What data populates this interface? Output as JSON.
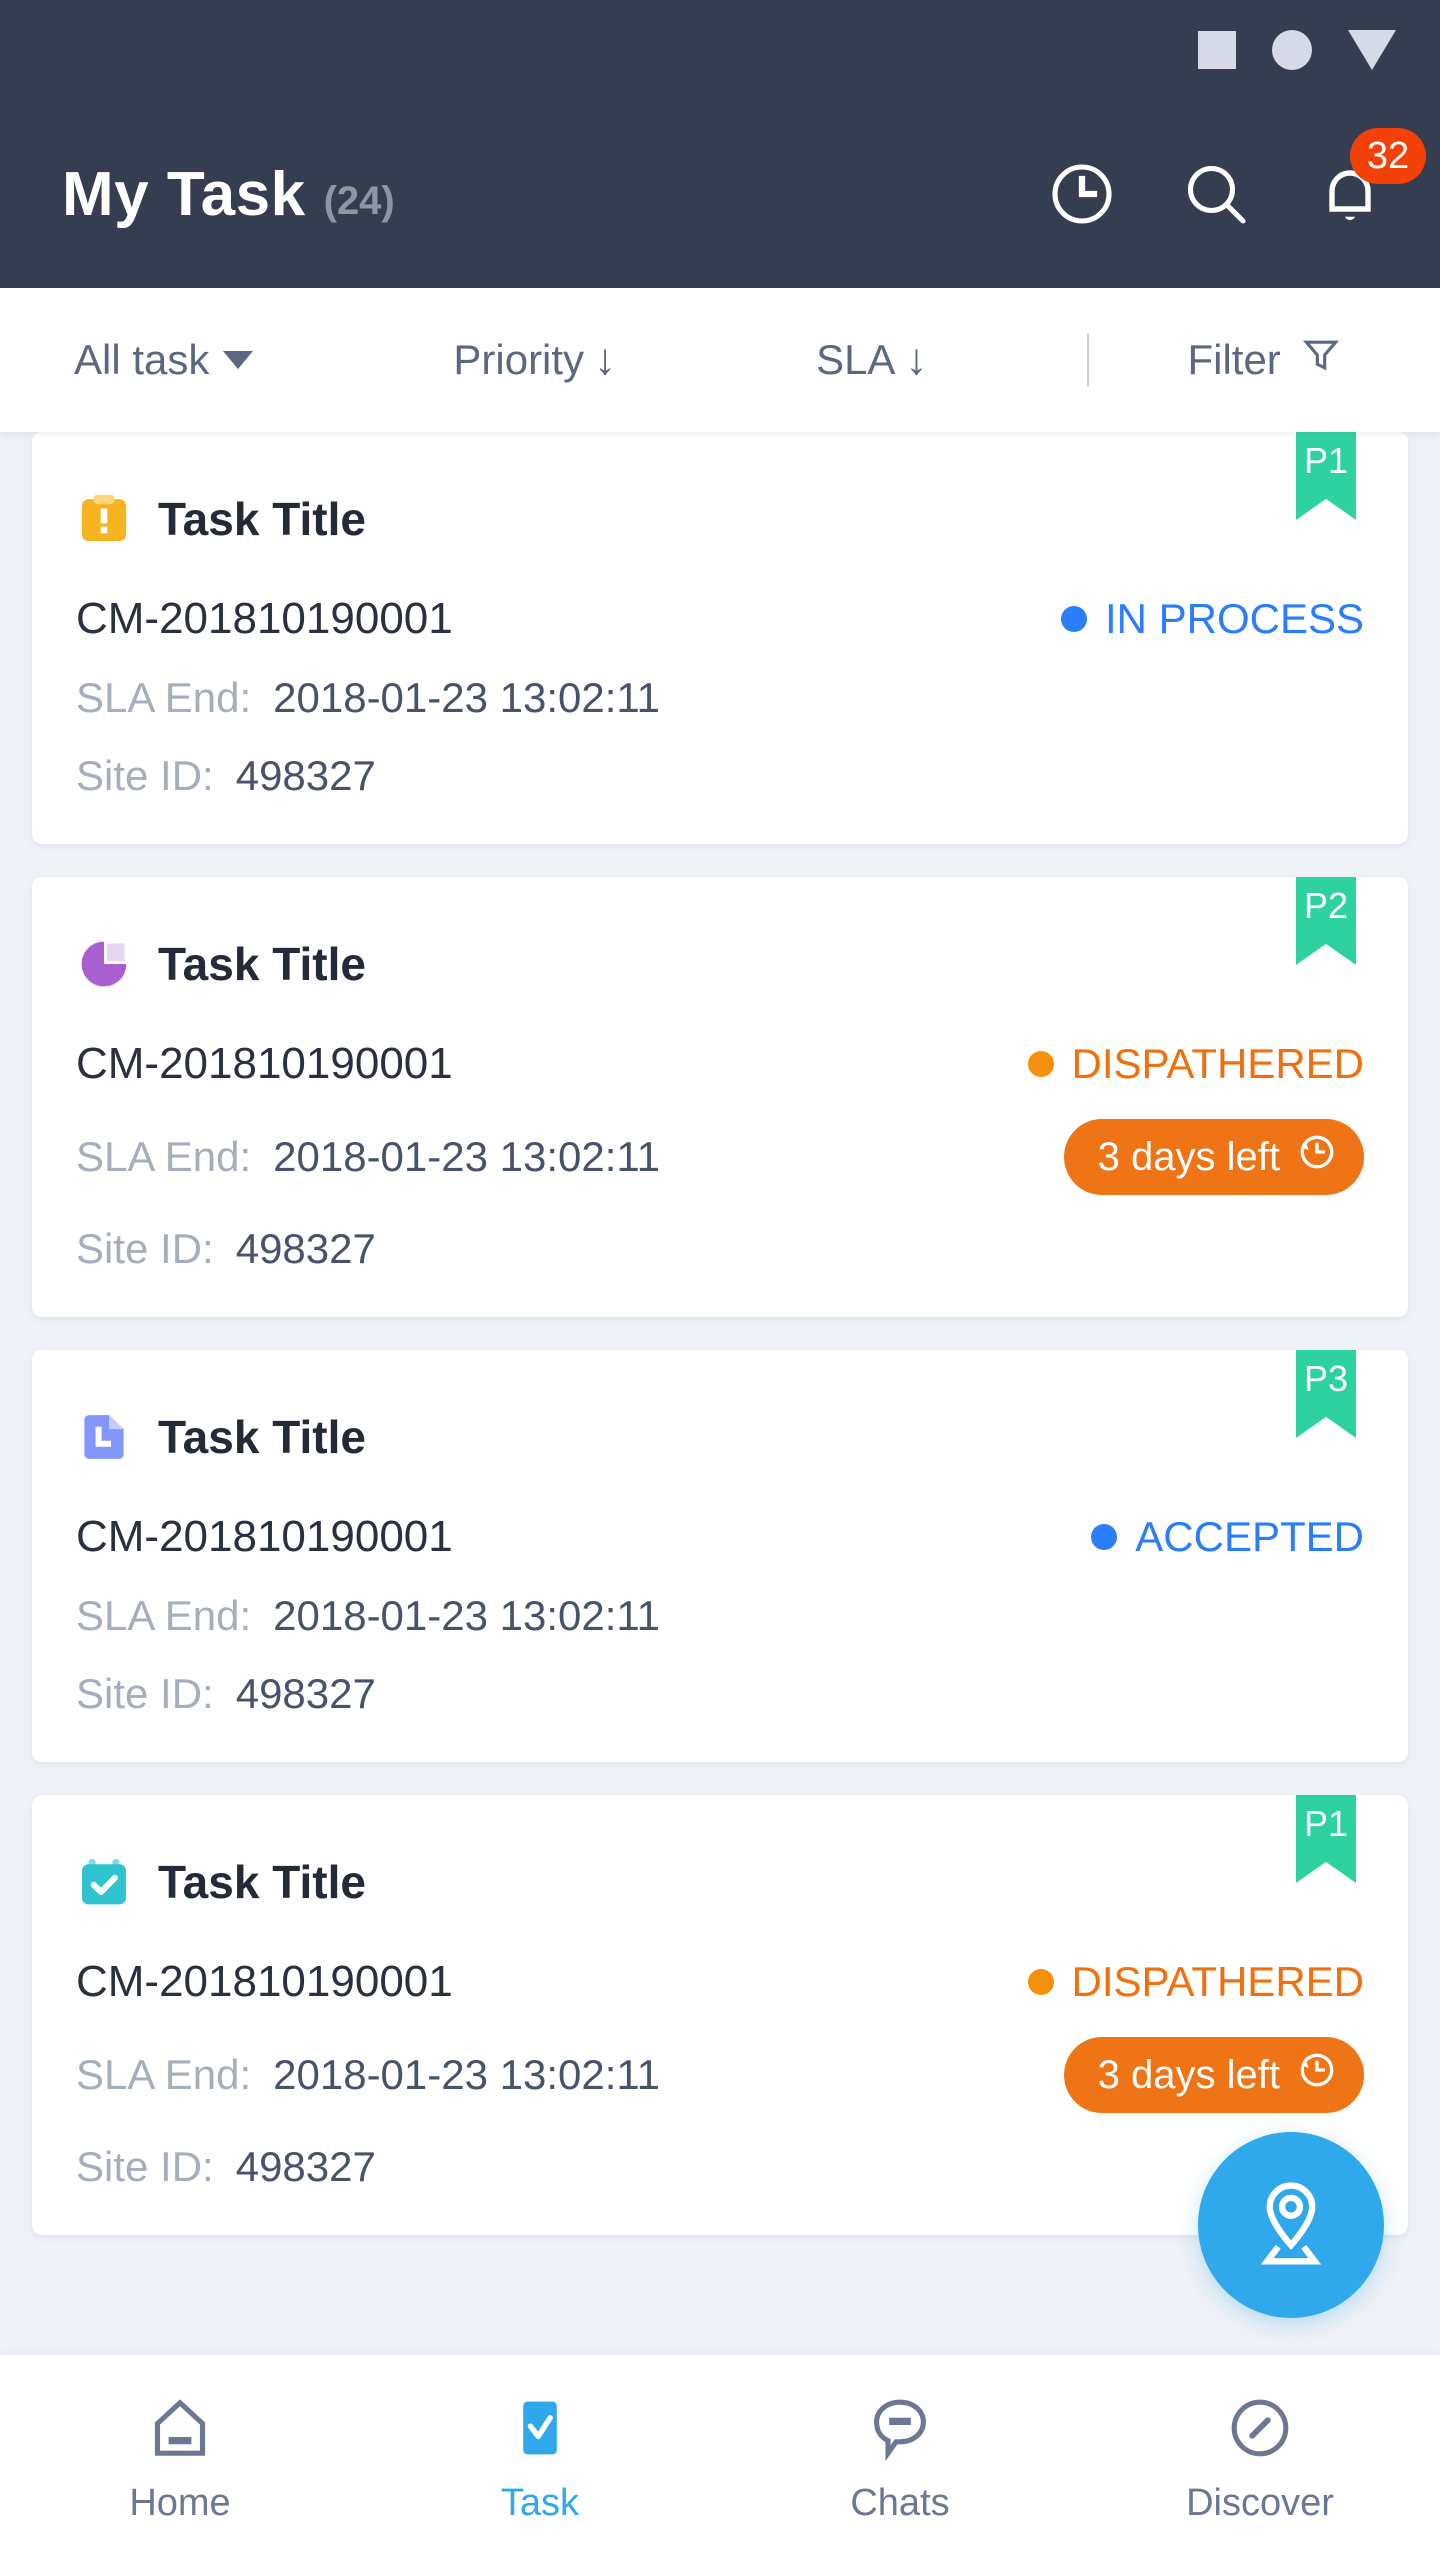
{
  "statusbar": {
    "icons": [
      "square-placeholder-icon",
      "circle-placeholder-icon",
      "triangle-placeholder-icon"
    ]
  },
  "appbar": {
    "title": "My Task",
    "count": "(24)",
    "actions": [
      {
        "name": "history-clock-icon",
        "label": "clock-icon"
      },
      {
        "name": "search-icon",
        "label": "search-icon"
      },
      {
        "name": "notifications-bell-icon",
        "label": "bell-icon",
        "badge": "32"
      }
    ]
  },
  "filterbar": {
    "all_task": "All task",
    "priority": "Priority",
    "priority_arrow": "↓",
    "sla": "SLA",
    "sla_arrow": "↓",
    "filter": "Filter"
  },
  "labels": {
    "sla_end": "SLA End:",
    "site_id": "Site ID:"
  },
  "colors": {
    "appbar_bg": "#353d50",
    "page_bg": "#eef1f6",
    "accent_blue": "#2fa8ec",
    "status_blue": "#2a7dfb",
    "status_orange": "#f07010",
    "pill_orange": "#ef7415",
    "ribbon_green": "#2ed2a0",
    "badge_red": "#f4410a"
  },
  "cards": [
    {
      "priority": "P1",
      "icon": "clipboard-alert-icon",
      "title": "Task Title",
      "code": "CM-201810190001",
      "status": "IN PROCESS",
      "status_color": "blue",
      "sla_end": "2018-01-23 13:02:11",
      "site_id": "498327",
      "countdown": null
    },
    {
      "priority": "P2",
      "icon": "pie-chart-icon",
      "title": "Task Title",
      "code": "CM-201810190001",
      "status": "DISPATHERED",
      "status_color": "orange",
      "sla_end": "2018-01-23 13:02:11",
      "site_id": "498327",
      "countdown": "3 days left"
    },
    {
      "priority": "P3",
      "icon": "document-icon",
      "title": "Task Title",
      "code": "CM-201810190001",
      "status": "ACCEPTED",
      "status_color": "blue",
      "sla_end": "2018-01-23 13:02:11",
      "site_id": "498327",
      "countdown": null
    },
    {
      "priority": "P1",
      "icon": "calendar-check-icon",
      "title": "Task Title",
      "code": "CM-201810190001",
      "status": "DISPATHERED",
      "status_color": "orange",
      "sla_end": "2018-01-23 13:02:11",
      "site_id": "498327",
      "countdown": "3 days left"
    }
  ],
  "fab": {
    "icon": "map-pin-location-icon"
  },
  "bottomnav": {
    "items": [
      {
        "label": "Home",
        "icon": "home-icon",
        "active": false
      },
      {
        "label": "Task",
        "icon": "task-check-icon",
        "active": true
      },
      {
        "label": "Chats",
        "icon": "chat-bubble-icon",
        "active": false
      },
      {
        "label": "Discover",
        "icon": "compass-icon",
        "active": false
      }
    ]
  }
}
